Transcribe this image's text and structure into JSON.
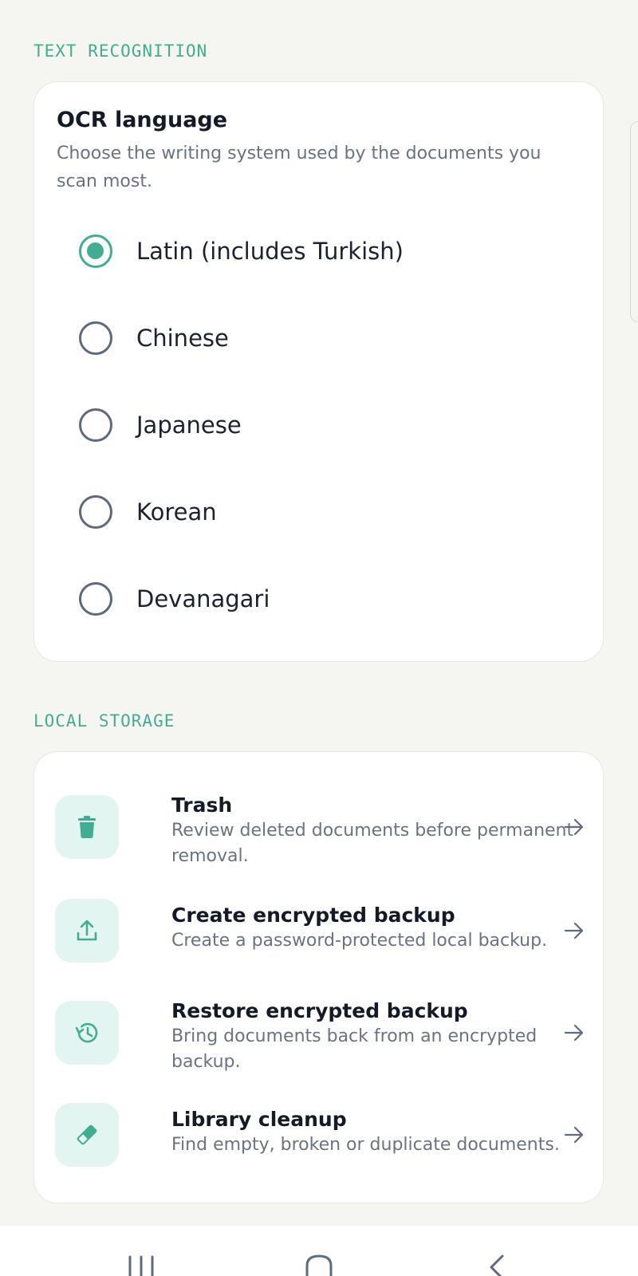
{
  "text_recognition": {
    "section_label": "TEXT RECOGNITION",
    "title": "OCR language",
    "description": "Choose the writing system used by the documents you scan most.",
    "options": [
      {
        "label": "Latin (includes Turkish)",
        "selected": true
      },
      {
        "label": "Chinese",
        "selected": false
      },
      {
        "label": "Japanese",
        "selected": false
      },
      {
        "label": "Korean",
        "selected": false
      },
      {
        "label": "Devanagari",
        "selected": false
      }
    ]
  },
  "local_storage": {
    "section_label": "LOCAL STORAGE",
    "items": [
      {
        "icon": "trash-icon",
        "title": "Trash",
        "subtitle": "Review deleted documents before permanent removal."
      },
      {
        "icon": "upload-icon",
        "title": "Create encrypted backup",
        "subtitle": "Create a password-protected local backup."
      },
      {
        "icon": "history-icon",
        "title": "Restore encrypted backup",
        "subtitle": "Bring documents back from an encrypted backup."
      },
      {
        "icon": "eraser-icon",
        "title": "Library cleanup",
        "subtitle": "Find empty, broken or duplicate documents."
      }
    ]
  },
  "colors": {
    "accent": "#3fae92",
    "icon_tile": "#e3f5f0",
    "background": "#f5f5f2"
  }
}
